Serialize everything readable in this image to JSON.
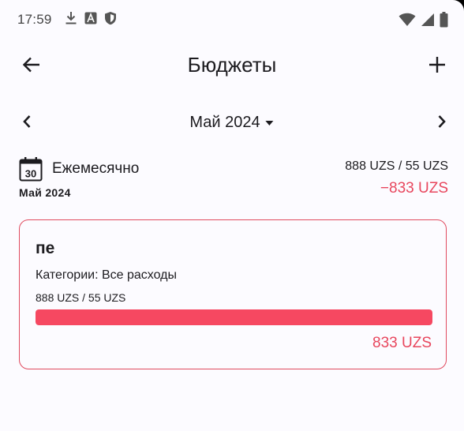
{
  "status_bar": {
    "time": "17:59",
    "left_icons": [
      "download-icon",
      "text-a-icon",
      "shield-icon"
    ],
    "right_icons": [
      "wifi-icon",
      "signal-icon",
      "battery-icon"
    ]
  },
  "top_bar": {
    "title": "Бюджеты",
    "back_icon": "arrow-left-icon",
    "add_icon": "plus-icon"
  },
  "month_selector": {
    "label": "Май 2024",
    "prev_icon": "chevron-left-icon",
    "next_icon": "chevron-right-icon",
    "dropdown_icon": "caret-down-icon"
  },
  "summary": {
    "calendar_day": "30",
    "period": "Ежемесячно",
    "date": "Май 2024",
    "amounts": "888 UZS / 55 UZS",
    "remaining": "−833 UZS"
  },
  "budget": {
    "name": "пе",
    "categories": "Категории: Все расходы",
    "amounts": "888 UZS / 55 UZS",
    "progress_fraction": 1.0,
    "remaining": "833 UZS"
  },
  "colors": {
    "accent_red": "#e8465d",
    "progress_red": "#f64861",
    "background": "#fcfbff"
  }
}
